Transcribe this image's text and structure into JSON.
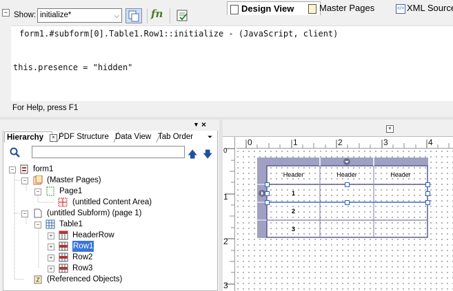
{
  "toolbar": {
    "show_label": "Show:",
    "show_value": "initialize*",
    "fn_label": "fn"
  },
  "editor": {
    "header_line": "form1.#subform[0].Table1.Row1::initialize - (JavaScript, client)",
    "code_line": "this.presence = \"hidden\""
  },
  "status": {
    "text": "For Help, press F1"
  },
  "palette": {
    "tabs": [
      "Hierarchy",
      "PDF Structure",
      "Data View",
      "Tab Order"
    ],
    "search_placeholder": ""
  },
  "tree": [
    {
      "label": "form1",
      "icon": "form-icon",
      "selected": false
    },
    {
      "label": "(Master Pages)",
      "icon": "master-pages-icon",
      "selected": false
    },
    {
      "label": "Page1",
      "icon": "page-icon",
      "selected": false
    },
    {
      "label": "(untitled Content Area)",
      "icon": "content-area-icon",
      "selected": false
    },
    {
      "label": "(untitled Subform) (page 1)",
      "icon": "subform-icon",
      "selected": false
    },
    {
      "label": "Table1",
      "icon": "table-icon",
      "selected": false
    },
    {
      "label": "HeaderRow",
      "icon": "row-icon",
      "selected": false
    },
    {
      "label": "Row1",
      "icon": "row-icon",
      "selected": true
    },
    {
      "label": "Row2",
      "icon": "row-icon",
      "selected": false
    },
    {
      "label": "Row3",
      "icon": "row-icon",
      "selected": false
    },
    {
      "label": "(Referenced Objects)",
      "icon": "referenced-objects-icon",
      "selected": false
    }
  ],
  "view_tabs": [
    "Design View",
    "Master Pages",
    "XML Source"
  ],
  "ruler": {
    "h": [
      "0",
      "1",
      "2",
      "3",
      "4"
    ],
    "v": [
      "0",
      "1",
      "2",
      "3"
    ]
  },
  "table": {
    "headers": [
      "Header",
      "Header",
      "Header"
    ],
    "rows": [
      "1",
      "2",
      "3"
    ]
  },
  "colors": {
    "selection": "#3875d7",
    "table_bar": "#9fa0c4",
    "table_border": "#5a5a8a"
  }
}
